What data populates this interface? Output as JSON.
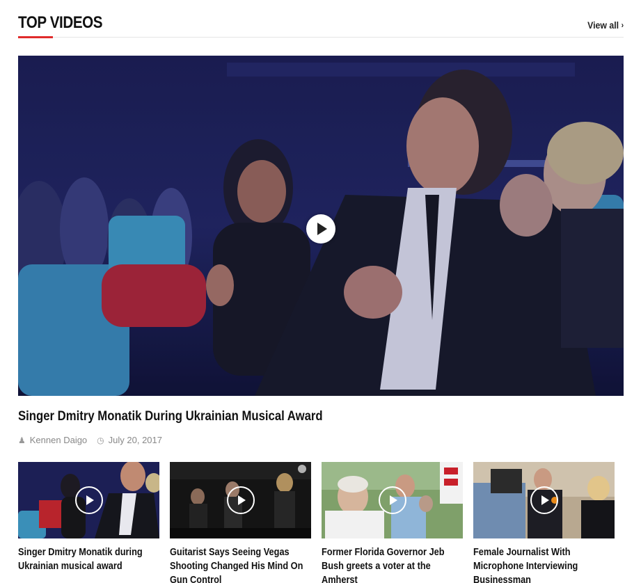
{
  "section": {
    "title": "TOP VIDEOS",
    "view_all": "View all",
    "accent": "#e02b2b"
  },
  "featured": {
    "title": "Singer Dmitry Monatik During Ukrainian Musical Award",
    "author": "Kennen Daigo",
    "date": "July 20, 2017"
  },
  "videos": [
    {
      "title": "Singer Dmitry Monatik during Ukrainian musical award"
    },
    {
      "title": "Guitarist Says Seeing Vegas Shooting Changed His Mind On Gun Control"
    },
    {
      "title": "Former Florida Governor Jeb Bush greets a voter at the Amherst"
    },
    {
      "title": "Female Journalist With Microphone Interviewing Businessman"
    }
  ],
  "icons": {
    "author": "user-icon",
    "date": "clock-icon",
    "play": "play-icon",
    "view_all": "chevron-right-icon"
  }
}
